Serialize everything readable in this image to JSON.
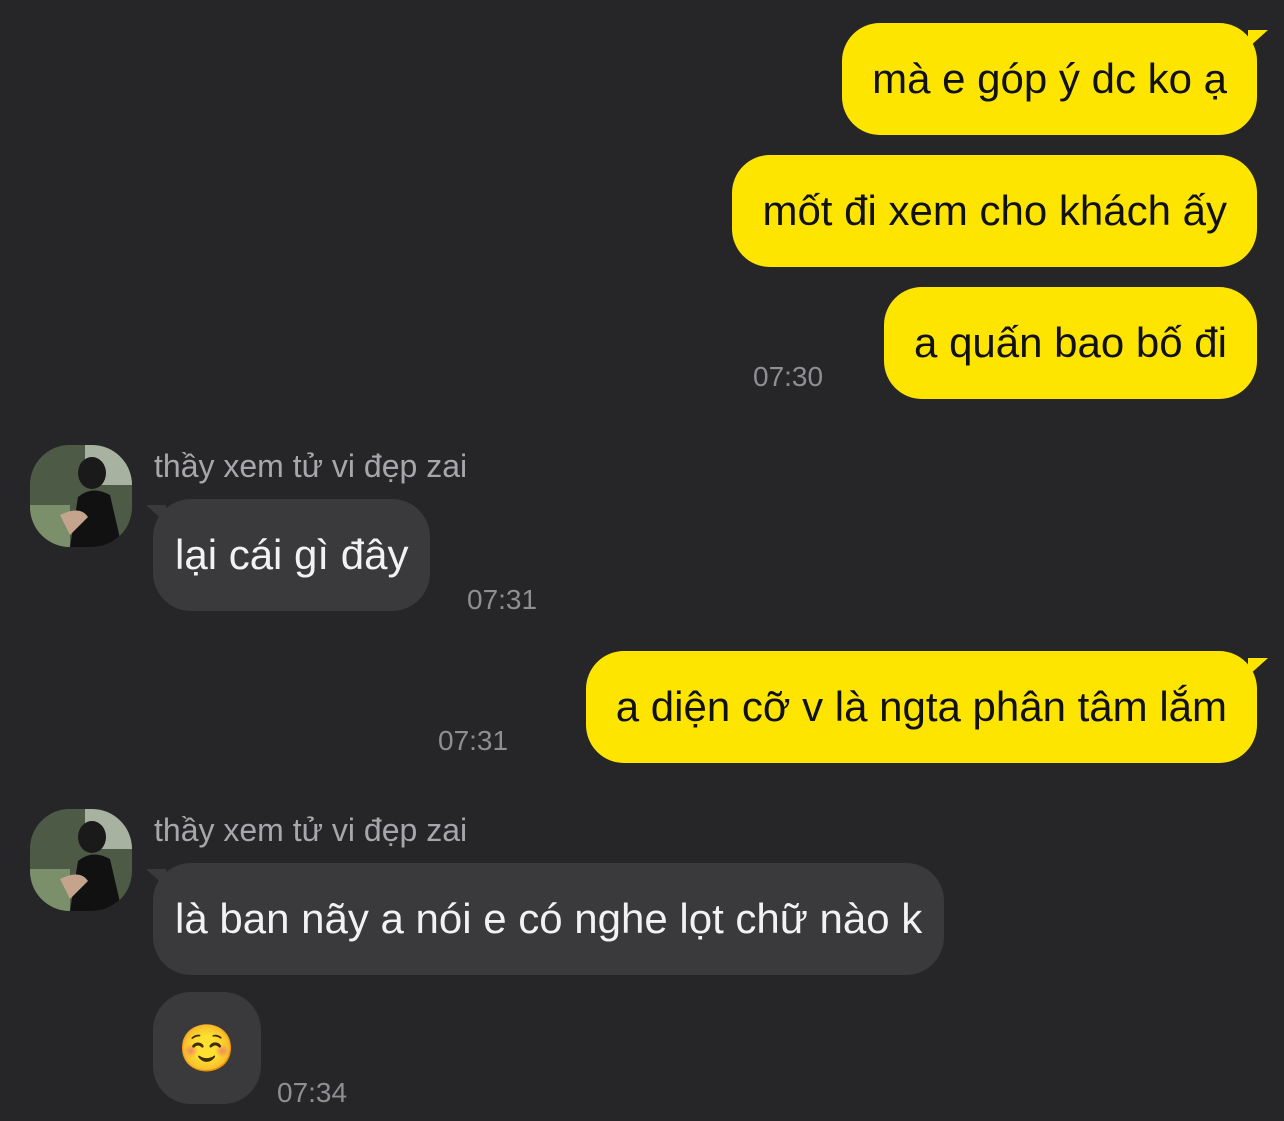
{
  "conversation": {
    "contact_name": "thầy xem tử vi đẹp zai",
    "messages": [
      {
        "from": "me",
        "text": "mà e góp ý dc ko ạ"
      },
      {
        "from": "me",
        "text": "mốt đi xem cho khách ấy"
      },
      {
        "from": "me",
        "text": "a quấn bao bố đi",
        "time": "07:30"
      },
      {
        "from": "them",
        "sender": "thầy xem tử vi đẹp zai",
        "text": "lại cái gì đây",
        "time": "07:31"
      },
      {
        "from": "me",
        "text": "a diện cỡ v là ngta phân tâm lắm",
        "time": "07:31"
      },
      {
        "from": "them",
        "sender": "thầy xem tử vi đẹp zai",
        "text": "là ban nãy a nói e có nghe lọt chữ nào k"
      },
      {
        "from": "them",
        "text": "☺️",
        "time": "07:34"
      }
    ]
  },
  "colors": {
    "background": "#262628",
    "outgoing_bubble": "#FEE500",
    "incoming_bubble": "#3A3A3D",
    "timestamp": "#8E8E93"
  },
  "icons": {
    "avatar": "contact-avatar-photo"
  }
}
